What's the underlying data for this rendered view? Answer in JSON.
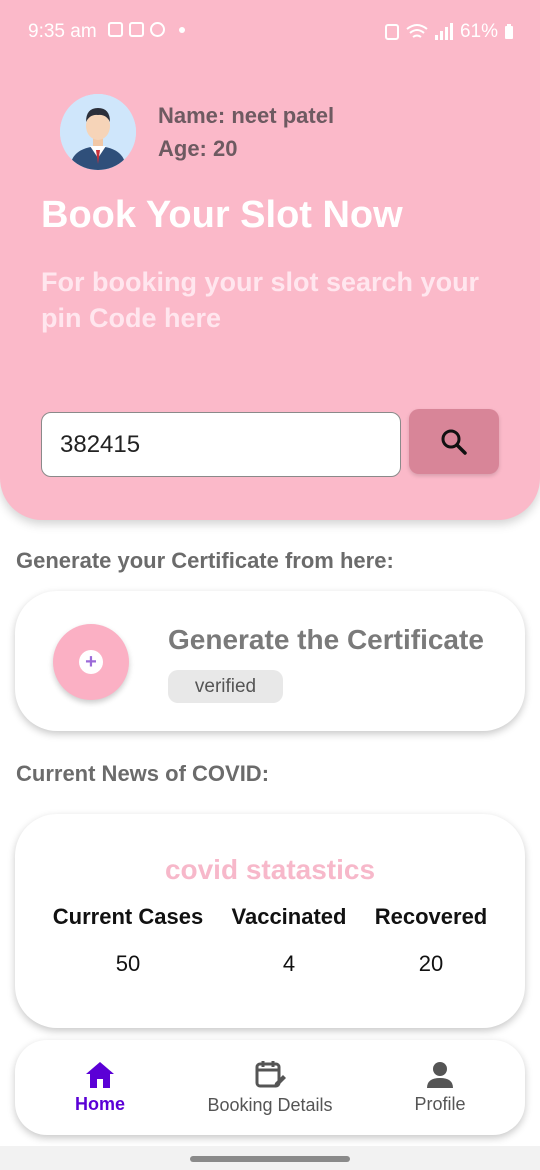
{
  "status_bar": {
    "time": "9:35 am",
    "battery": "61%"
  },
  "profile": {
    "name": "Name: neet patel",
    "age": "Age: 20"
  },
  "header": {
    "title": "Book Your Slot Now",
    "subtitle": "For booking your slot search your pin Code here"
  },
  "search": {
    "pin_value": "382415",
    "icon": "search-icon"
  },
  "certificate": {
    "section_label": "Generate your Certificate from here:",
    "title": "Generate the Certificate",
    "badge": "verified",
    "icon": "plus-icon"
  },
  "news": {
    "section_label": "Current News of COVID:",
    "card_title": "covid statastics",
    "columns": [
      {
        "label": "Current Cases",
        "value": "50"
      },
      {
        "label": "Vaccinated",
        "value": "4"
      },
      {
        "label": "Recovered",
        "value": "20"
      }
    ]
  },
  "nav": {
    "items": [
      {
        "label": "Home",
        "icon": "home-icon",
        "active": true
      },
      {
        "label": "Booking Details",
        "icon": "calendar-edit-icon",
        "active": false
      },
      {
        "label": "Profile",
        "icon": "person-icon",
        "active": false
      }
    ]
  },
  "colors": {
    "header_bg": "#fbb9c9",
    "accent": "#5b00d6",
    "search_button": "#d88598",
    "stats_title": "#f7b8ca"
  }
}
